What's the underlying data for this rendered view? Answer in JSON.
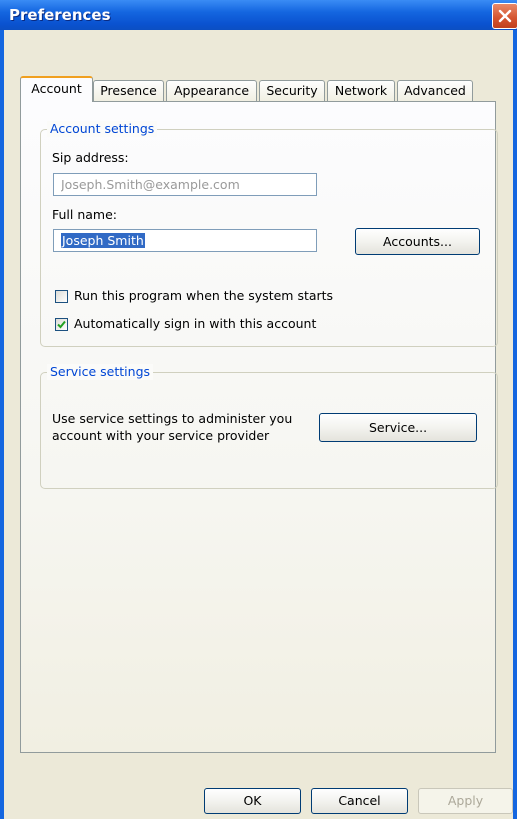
{
  "window": {
    "title": "Preferences"
  },
  "tabs": [
    {
      "label": "Account",
      "active": true
    },
    {
      "label": "Presence",
      "active": false
    },
    {
      "label": "Appearance",
      "active": false
    },
    {
      "label": "Security",
      "active": false
    },
    {
      "label": "Network",
      "active": false
    },
    {
      "label": "Advanced",
      "active": false
    }
  ],
  "account_settings": {
    "legend": "Account settings",
    "sip_label": "Sip address:",
    "sip_value": "Joseph.Smith@example.com",
    "fullname_label": "Full name:",
    "fullname_value": "Joseph Smith",
    "accounts_button": "Accounts...",
    "run_on_startup": {
      "label": "Run this program when the system starts",
      "checked": false
    },
    "auto_sign_in": {
      "label": "Automatically sign in with this account",
      "checked": true
    }
  },
  "service_settings": {
    "legend": "Service settings",
    "description_line1": "Use service settings to administer you",
    "description_line2": "account with your service provider",
    "service_button": "Service..."
  },
  "footer": {
    "ok": "OK",
    "cancel": "Cancel",
    "apply": "Apply"
  },
  "colors": {
    "titlebar": "#0a52d0",
    "legend": "#0046d5",
    "selection": "#316ac5"
  },
  "icons": {
    "close": "close-icon",
    "check": "checkmark-icon"
  }
}
